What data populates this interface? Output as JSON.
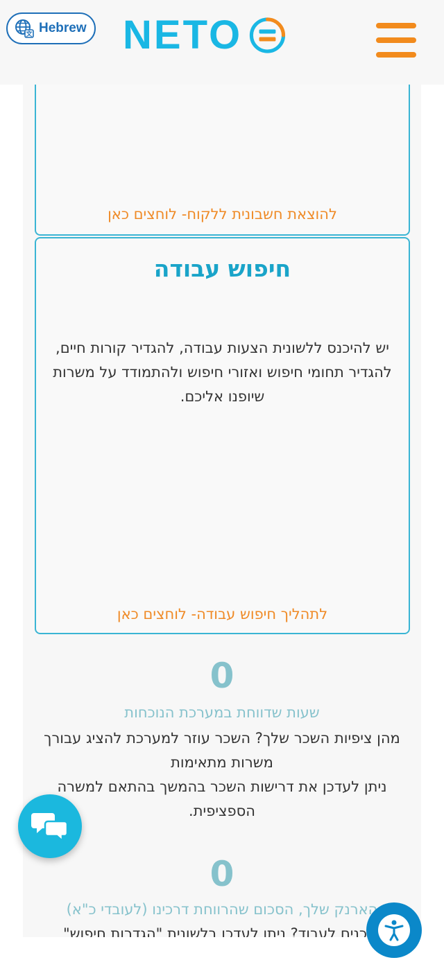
{
  "header": {
    "language_label": "Hebrew",
    "logo_text": "NETO"
  },
  "cards": {
    "client_invoice": {
      "link": "להוצאת חשבונית ללקוח- לוחצים כאן"
    },
    "job_search": {
      "title": "חיפוש עבודה",
      "description": "יש להיכנס ללשונית הצעות עבודה, להגדיר קורות חיים, להגדיר תחומי חיפוש ואזורי חיפוש ולהתמודד על משרות שיופנו אליכם.",
      "link": "לתהליך חיפוש עבודה- לוחצים כאן"
    }
  },
  "stats": [
    {
      "number": "0",
      "label": "שעות שדווחת במערכת הנוכחות",
      "description_lines": [
        "מהן ציפיות השכר שלך? השכר עוזר למערכת להציג עבורך משרות מתאימות",
        "ניתן לעדכן את דרישות השכר בהמשך בהתאם למשרה הספציפית."
      ]
    },
    {
      "number": "0",
      "label": "הארנק שלך, הסכום שהרווחת דרכינו (לעובדי כ\"א)",
      "description_lines": [
        "מוכנים לעבוד? ניתן לעדכן בלשונית \"הגדרות חיפוש\""
      ]
    }
  ],
  "colors": {
    "brand_blue": "#1ab7e4",
    "brand_orange": "#f28b1d",
    "card_border": "#3ab5d4",
    "stat_teal": "#86c2cc",
    "chat_button": "#1bb8de",
    "accessibility_button": "#0b88c9"
  },
  "icons": {
    "language": "globe-translate-icon",
    "menu": "hamburger-menu-icon",
    "chat": "chat-bubbles-icon",
    "accessibility": "accessibility-person-icon"
  }
}
